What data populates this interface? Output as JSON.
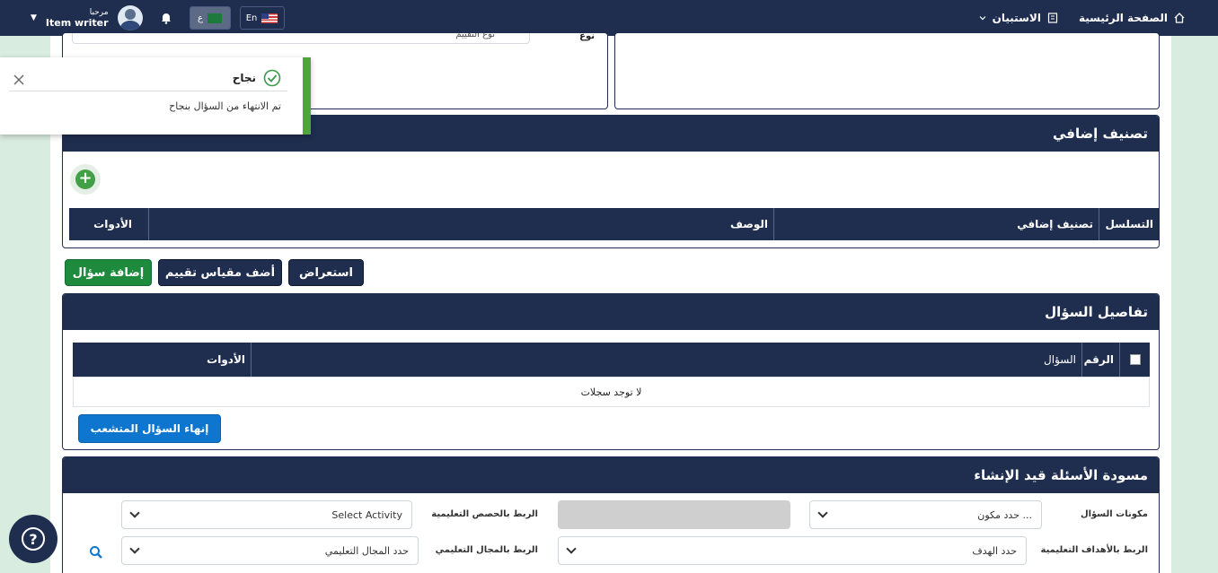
{
  "topbar": {
    "home": "الصفحة الرئيسية",
    "survey": "الاستبيان",
    "greeting": "مرحبا",
    "user_name": "Item writer",
    "lang_ar": "ع",
    "lang_en": "En"
  },
  "toast": {
    "title": "نجاح",
    "message": "تم الانتهاء من السؤال بنجاح"
  },
  "top_partial": {
    "label": "نوع",
    "field_text": "نوع التقييم"
  },
  "classification": {
    "title": "تصنيف إضافي",
    "columns": [
      "التسلسل",
      "تصنيف إضافي",
      "الوصف",
      "الأدوات"
    ]
  },
  "actions": {
    "preview": "استعراض",
    "add_rubric": "أضف مقياس تقييم",
    "add_question": "إضافة سؤال"
  },
  "question_details": {
    "title": "تفاصيل السؤال",
    "columns": [
      "الرقم",
      "السؤال",
      "الأدوات"
    ],
    "empty": "لا توجد سجلات",
    "finish_button": "إنهاء السؤال المتشعب"
  },
  "drafts": {
    "title": "مسودة الأسئلة قيد الإنشاء",
    "components_label": "مكونات السؤال",
    "components_value": "حدد مكون ...",
    "lessons_label": "الربط بالحصص التعليمية",
    "activity_value": "Select Activity",
    "objectives_label": "الربط بالأهداف التعليمية",
    "objectives_value": "حدد الهدف",
    "domain_label": "الربط بالمجال التعليمي",
    "domain_value": "حدد المجال التعليمي"
  },
  "colors": {
    "navy": "#1f2d4e",
    "green": "#1e8a3e",
    "blue": "#0f76cf",
    "success": "#4fa43c"
  }
}
